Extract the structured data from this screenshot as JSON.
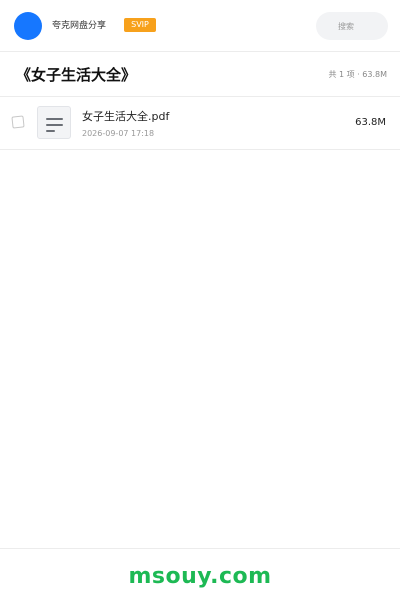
{
  "header": {
    "username": "夸克网盘分享",
    "badge": "SVIP",
    "search_placeholder": "搜索"
  },
  "share": {
    "title": "《女子生活大全》",
    "summary": "共 1 项 · 63.8M"
  },
  "files": [
    {
      "name": "女子生活大全.pdf",
      "date": "2026-09-07 17:18",
      "size": "63.8M",
      "icon": "document-icon"
    }
  ],
  "footer": {
    "watermark": "msouy.com"
  },
  "colors": {
    "avatar": "#1677ff",
    "badge": "#f7a11c",
    "watermark": "#1db954"
  }
}
